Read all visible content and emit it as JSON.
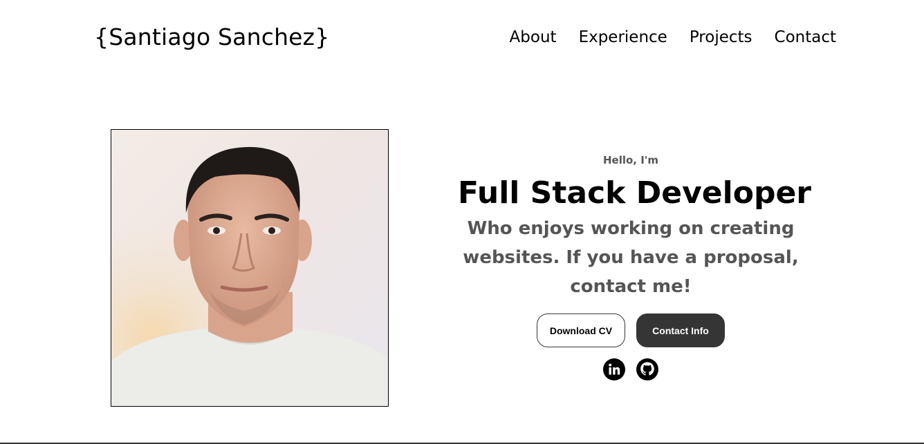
{
  "header": {
    "logo": "{Santiago Sanchez}",
    "nav": [
      "About",
      "Experience",
      "Projects",
      "Contact"
    ]
  },
  "hero": {
    "greeting": "Hello, I'm",
    "title": "Full Stack Developer",
    "subtitle": "Who enjoys working on creating websites. If you have a proposal, contact me!",
    "download_cv": "Download CV",
    "contact_info": "Contact Info"
  },
  "icons": {
    "linkedin": "linkedin-icon",
    "github": "github-icon"
  },
  "colors": {
    "text_primary": "#000000",
    "text_secondary": "#555555",
    "button_dark": "#353535",
    "background": "#ffffff"
  }
}
